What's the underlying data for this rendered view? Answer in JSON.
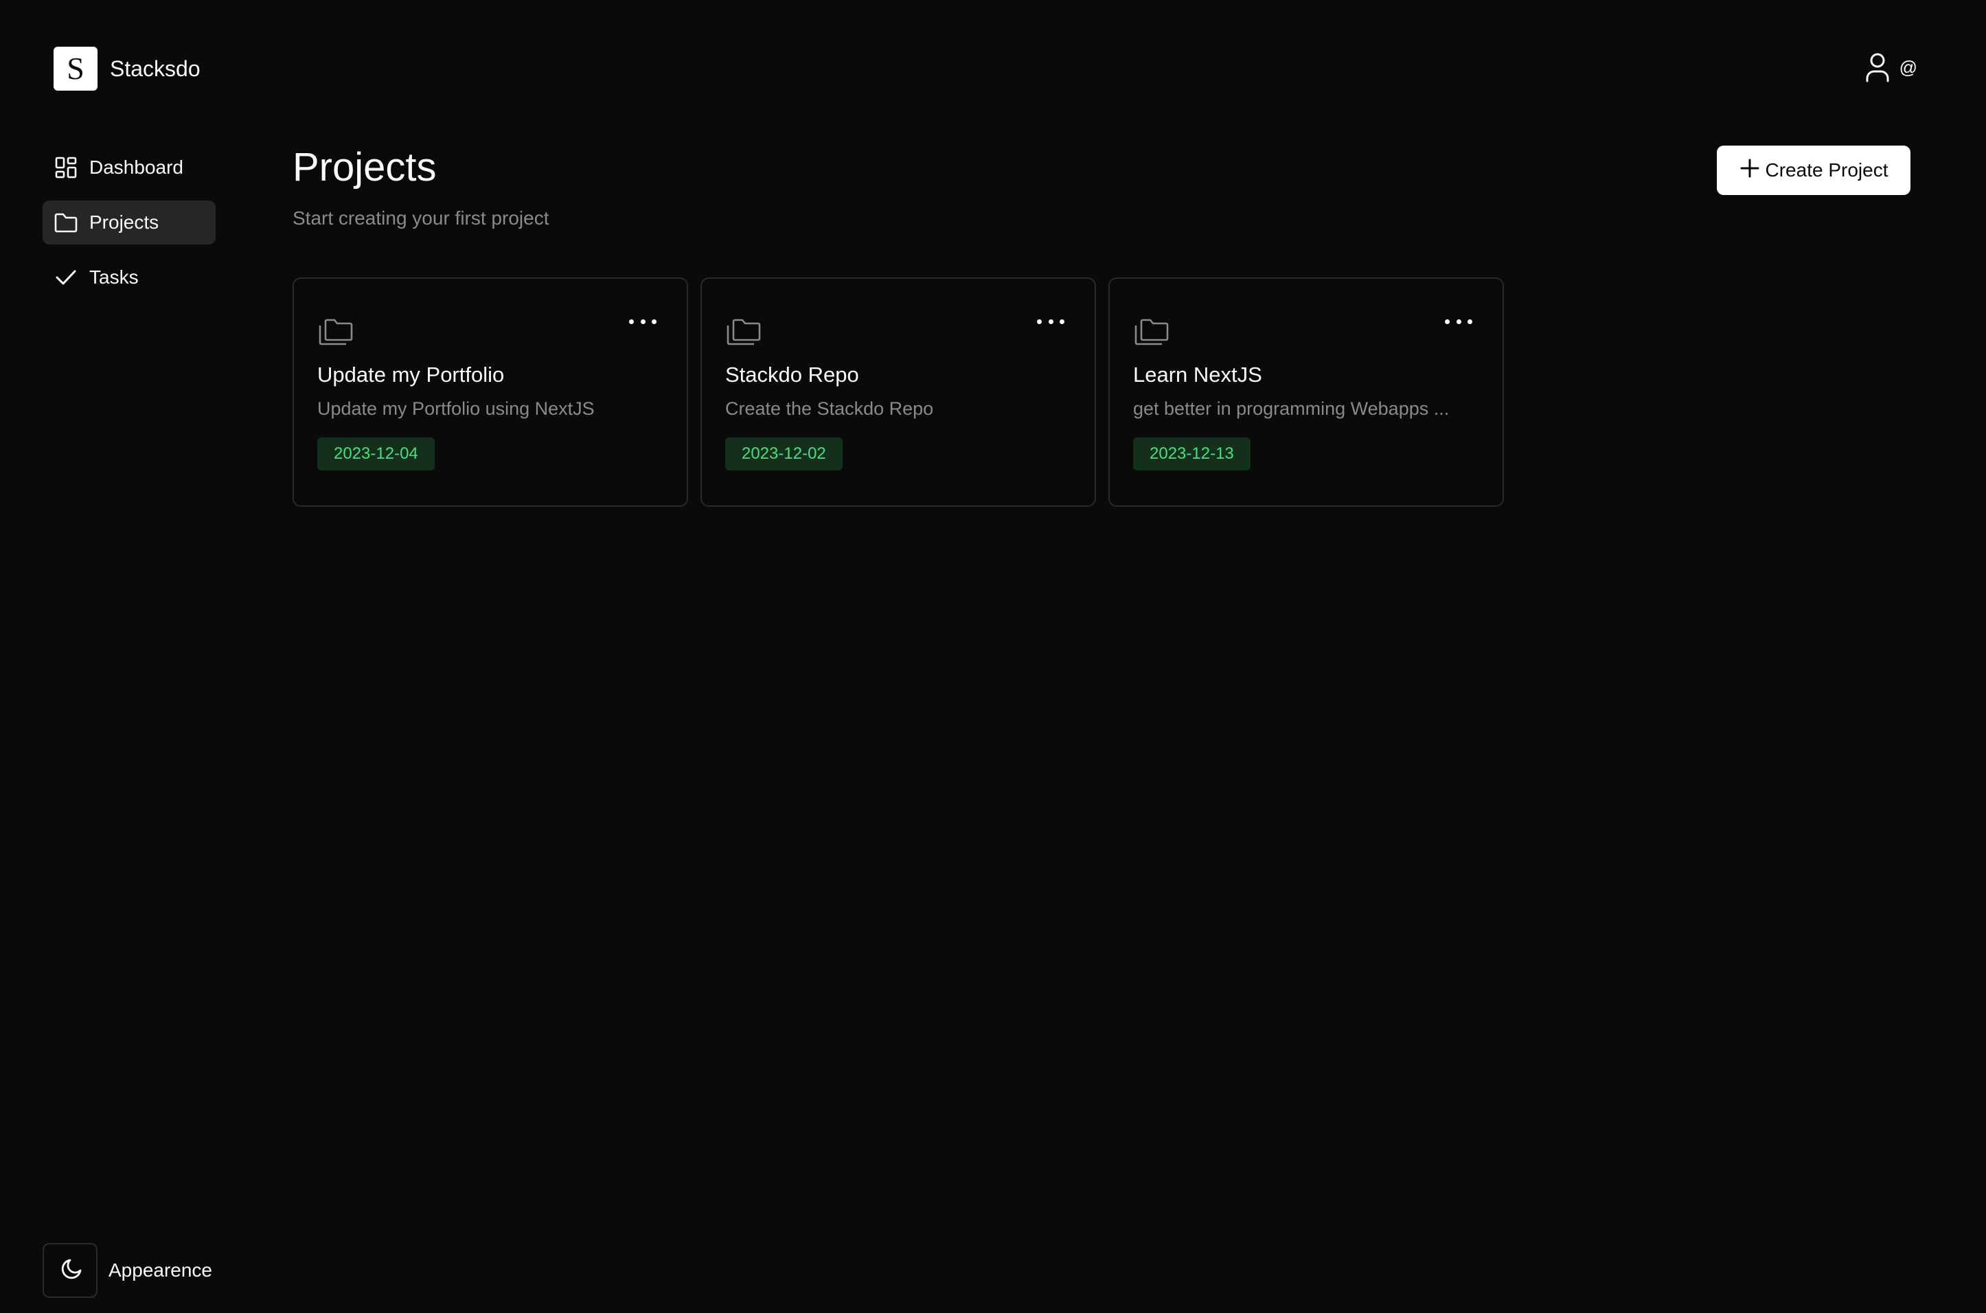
{
  "brand": {
    "logo_letter": "S",
    "name": "Stacksdo"
  },
  "user": {
    "icon": "user-icon",
    "handle": "@"
  },
  "sidebar": {
    "items": [
      {
        "label": "Dashboard",
        "icon": "dashboard-grid-icon",
        "active": false
      },
      {
        "label": "Projects",
        "icon": "folder-icon",
        "active": true
      },
      {
        "label": "Tasks",
        "icon": "check-icon",
        "active": false
      }
    ]
  },
  "main": {
    "title": "Projects",
    "subtitle": "Start creating your first project",
    "create_button": {
      "label": "Create Project",
      "icon": "plus-icon"
    }
  },
  "projects": [
    {
      "title": "Update my Portfolio",
      "description": "Update my Portfolio using NextJS",
      "date": "2023-12-04",
      "icon": "folders-icon"
    },
    {
      "title": "Stackdo Repo",
      "description": "Create the Stackdo Repo",
      "date": "2023-12-02",
      "icon": "folders-icon"
    },
    {
      "title": "Learn NextJS",
      "description": "get better in programming Webapps ...",
      "date": "2023-12-13",
      "icon": "folders-icon"
    }
  ],
  "appearance": {
    "label": "Appearence",
    "icon": "moon-icon"
  },
  "colors": {
    "background": "#0a0a0a",
    "active_nav": "#262626",
    "card_border": "#2a2a2a",
    "date_badge_bg": "#14301d",
    "date_badge_text": "#4ade80",
    "muted_text": "#8a8a8a"
  }
}
